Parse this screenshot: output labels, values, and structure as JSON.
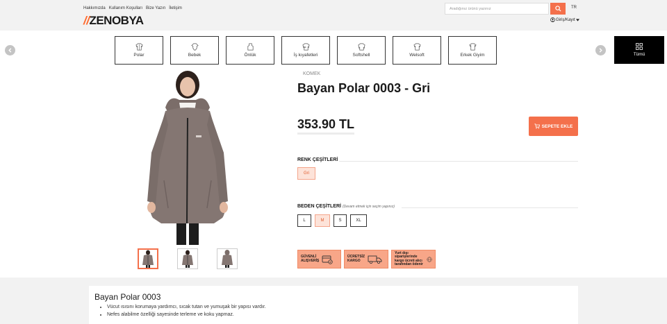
{
  "topbar": {
    "links": [
      "Hakkımızda",
      "Kullanım Koşulları",
      "Bize Yazın",
      "İletişim"
    ],
    "logo_text": "ZENOBYA",
    "search_placeholder": "Aradığınız ürünü yazınız",
    "lang": "TR",
    "login": "Giriş/Kayıt"
  },
  "categories": [
    "Polar",
    "Bebek",
    "Önlük",
    "İş kıyafetleri",
    "Softshell",
    "Welsoft",
    "Erkek Giyim"
  ],
  "all_categories_label": "Tümü",
  "product": {
    "brand": "KOMEK",
    "title": "Bayan Polar 0003 - Gri",
    "price": "353.90 TL",
    "add_to_cart": "SEPETE EKLE",
    "colors_title": "RENK ÇEŞİTLERİ",
    "colors": [
      "Gri"
    ],
    "sizes_title": "BEDEN ÇEŞİTLERİ",
    "sizes_hint": "(Devam etmek için seçim yapınız)",
    "sizes": [
      "L",
      "M",
      "S",
      "XL"
    ],
    "selected_size": "M"
  },
  "badges": [
    {
      "line1": "GÜVENLİ",
      "line2": "ALIŞVERİŞ",
      "icon": "secure-card-icon"
    },
    {
      "line1": "ÜCRETSİZ",
      "line2": "KARGO",
      "icon": "truck-icon"
    },
    {
      "line1": "Yurt dışı siparişlerinde",
      "line2": "kargo ücreti alıcı tarafından ödenir",
      "icon": "globe-icon"
    }
  ],
  "description": {
    "title": "Bayan Polar 0003",
    "bullets": [
      "Vücut ısısını korumaya yardımcı, sıcak tutan ve yumuşak bir yapısı vardır.",
      "Nefes alabilme özelliği sayesinde terleme ve koku yapmaz."
    ]
  },
  "colors": {
    "accent": "#f4704b",
    "badge_bg": "#f8a688",
    "dark": "#000000"
  }
}
